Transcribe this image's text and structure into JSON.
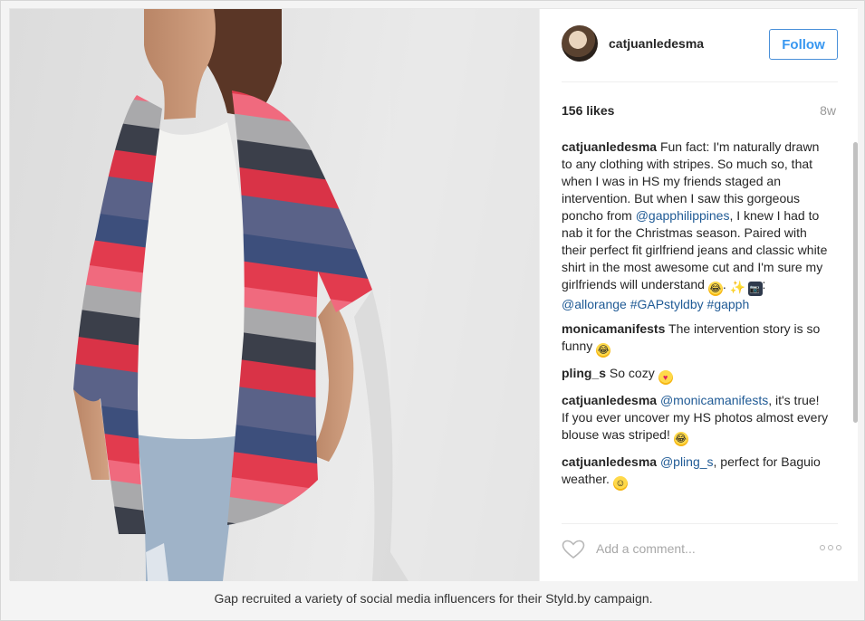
{
  "post": {
    "username": "catjuanledesma",
    "follow_label": "Follow",
    "likes": "156 likes",
    "time": "8w",
    "comment_placeholder": "Add a comment...",
    "comments": [
      {
        "author": "catjuanledesma",
        "parts": [
          {
            "t": "text",
            "v": " Fun fact: I'm naturally drawn to any clothing with stripes. So much so, that when I was in HS my friends staged an intervention. But when I saw this gorgeous poncho from "
          },
          {
            "t": "link",
            "v": "@gapphilippines"
          },
          {
            "t": "text",
            "v": ", I knew I had to nab it for the Christmas season. Paired with their perfect fit girlfriend jeans and classic white shirt in the most awesome cut and I'm sure my girlfriends will understand "
          },
          {
            "t": "emoji",
            "v": "laugh"
          },
          {
            "t": "text",
            "v": ". "
          },
          {
            "t": "emoji",
            "v": "sparkle"
          },
          {
            "t": "text",
            "v": " "
          },
          {
            "t": "emoji",
            "v": "camera"
          },
          {
            "t": "text",
            "v": ": "
          },
          {
            "t": "link",
            "v": "@allorange"
          },
          {
            "t": "text",
            "v": " "
          },
          {
            "t": "link",
            "v": "#GAPstyldby"
          },
          {
            "t": "text",
            "v": " "
          },
          {
            "t": "link",
            "v": "#gapph"
          }
        ]
      },
      {
        "author": "monicamanifests",
        "parts": [
          {
            "t": "text",
            "v": " The intervention story is so funny "
          },
          {
            "t": "emoji",
            "v": "laugh"
          }
        ]
      },
      {
        "author": "pling_s",
        "parts": [
          {
            "t": "text",
            "v": " So cozy "
          },
          {
            "t": "emoji",
            "v": "heart"
          }
        ]
      },
      {
        "author": "catjuanledesma",
        "parts": [
          {
            "t": "text",
            "v": " "
          },
          {
            "t": "link",
            "v": "@monicamanifests"
          },
          {
            "t": "text",
            "v": ", it's true! If you ever uncover my HS photos almost every blouse was striped! "
          },
          {
            "t": "emoji",
            "v": "laugh"
          }
        ]
      },
      {
        "author": "catjuanledesma",
        "parts": [
          {
            "t": "text",
            "v": " "
          },
          {
            "t": "link",
            "v": "@pling_s"
          },
          {
            "t": "text",
            "v": ", perfect for Baguio weather. "
          },
          {
            "t": "emoji",
            "v": "smile"
          }
        ]
      }
    ]
  },
  "caption": "Gap recruited a variety of social media influencers for their Styld.by campaign.",
  "icons": {
    "heart": "heart-icon",
    "more": "more-options-icon"
  },
  "colors": {
    "accent": "#3897f0",
    "link": "#1f5a95",
    "muted": "#999999"
  }
}
